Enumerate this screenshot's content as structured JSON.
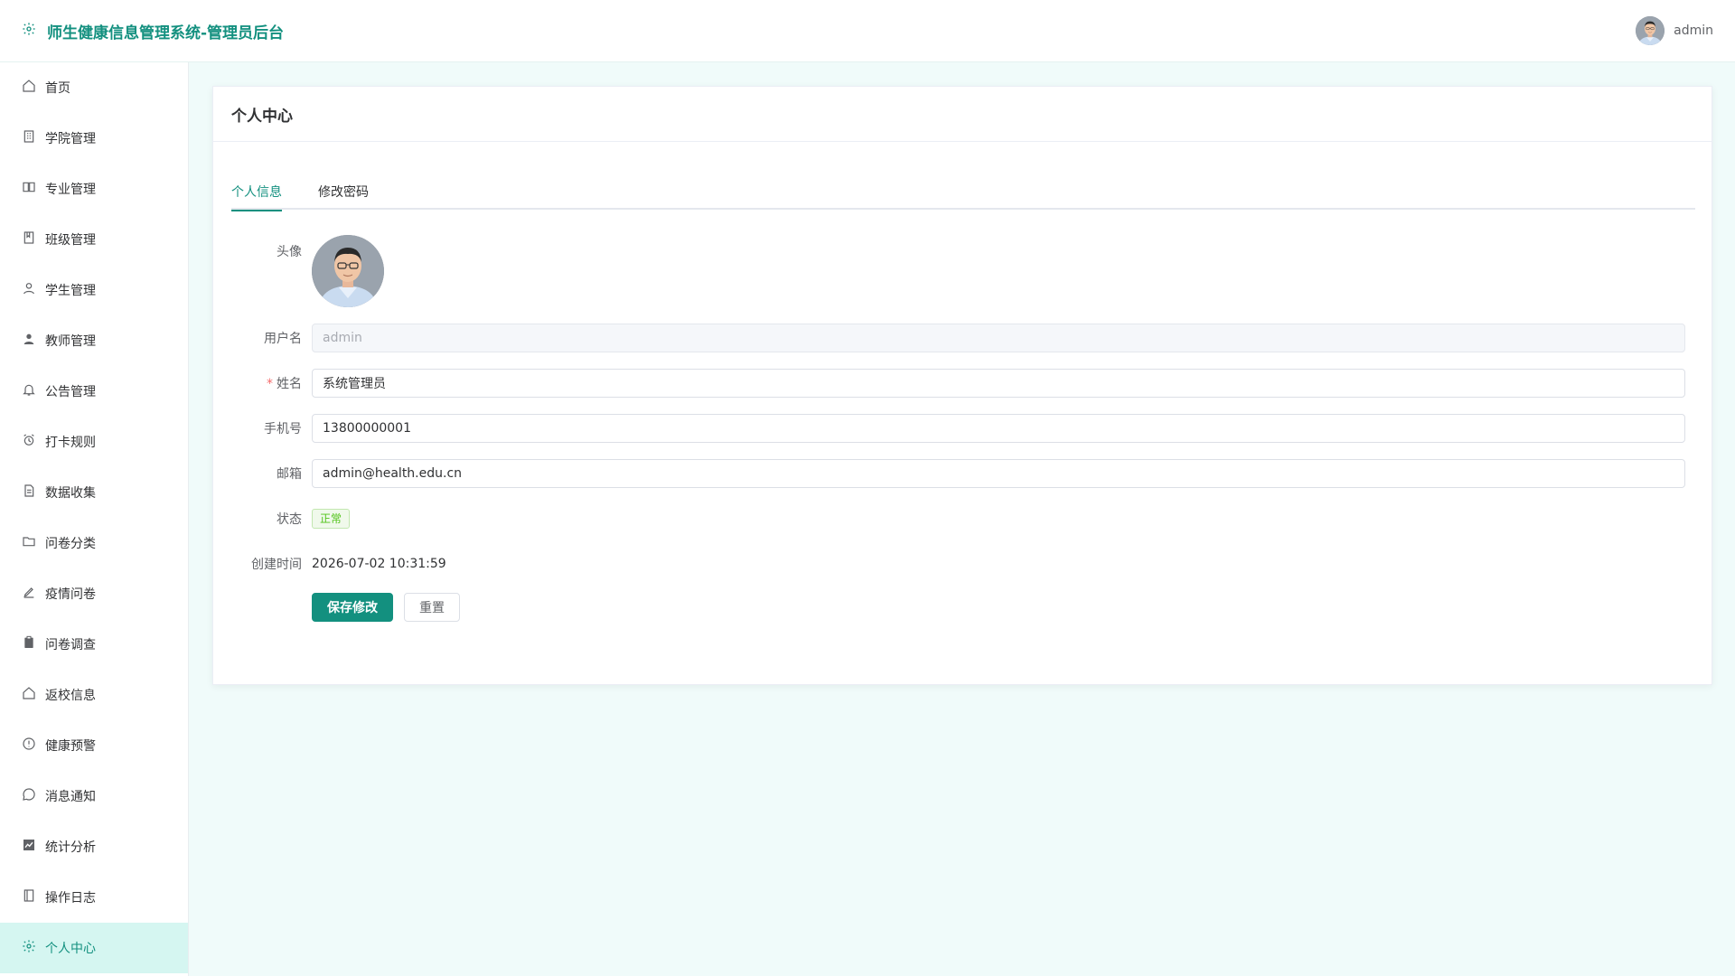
{
  "header": {
    "title": "师生健康信息管理系统-管理员后台",
    "username": "admin"
  },
  "sidebar": {
    "items": [
      {
        "label": "首页",
        "icon": "home-icon"
      },
      {
        "label": "学院管理",
        "icon": "building-icon"
      },
      {
        "label": "专业管理",
        "icon": "book-icon"
      },
      {
        "label": "班级管理",
        "icon": "notebook-icon"
      },
      {
        "label": "学生管理",
        "icon": "user-icon"
      },
      {
        "label": "教师管理",
        "icon": "user-filled-icon"
      },
      {
        "label": "公告管理",
        "icon": "bell-icon"
      },
      {
        "label": "打卡规则",
        "icon": "alarm-clock-icon"
      },
      {
        "label": "数据收集",
        "icon": "document-icon"
      },
      {
        "label": "问卷分类",
        "icon": "folder-icon"
      },
      {
        "label": "疫情问卷",
        "icon": "edit-pen-icon"
      },
      {
        "label": "问卷调查",
        "icon": "clipboard-icon"
      },
      {
        "label": "返校信息",
        "icon": "home-icon"
      },
      {
        "label": "健康预警",
        "icon": "warning-icon"
      },
      {
        "label": "消息通知",
        "icon": "chat-dots-icon"
      },
      {
        "label": "统计分析",
        "icon": "chart-icon"
      },
      {
        "label": "操作日志",
        "icon": "log-book-icon"
      },
      {
        "label": "个人中心",
        "icon": "gear-icon",
        "active": true
      }
    ]
  },
  "card": {
    "title": "个人中心",
    "tabs": [
      {
        "label": "个人信息",
        "active": true
      },
      {
        "label": "修改密码",
        "active": false
      }
    ]
  },
  "form": {
    "avatar_label": "头像",
    "username_label": "用户名",
    "username_value": "admin",
    "name_label": "姓名",
    "name_value": "系统管理员",
    "phone_label": "手机号",
    "phone_value": "13800000001",
    "email_label": "邮箱",
    "email_value": "admin@health.edu.cn",
    "status_label": "状态",
    "status_value": "正常",
    "created_label": "创建时间",
    "created_value": "2026-07-02 10:31:59",
    "save_label": "保存修改",
    "reset_label": "重置"
  },
  "colors": {
    "accent": "#13907f",
    "active_bg": "#d5f6f1",
    "page_bg": "#f0fbfa",
    "status_green": "#52c41a"
  }
}
